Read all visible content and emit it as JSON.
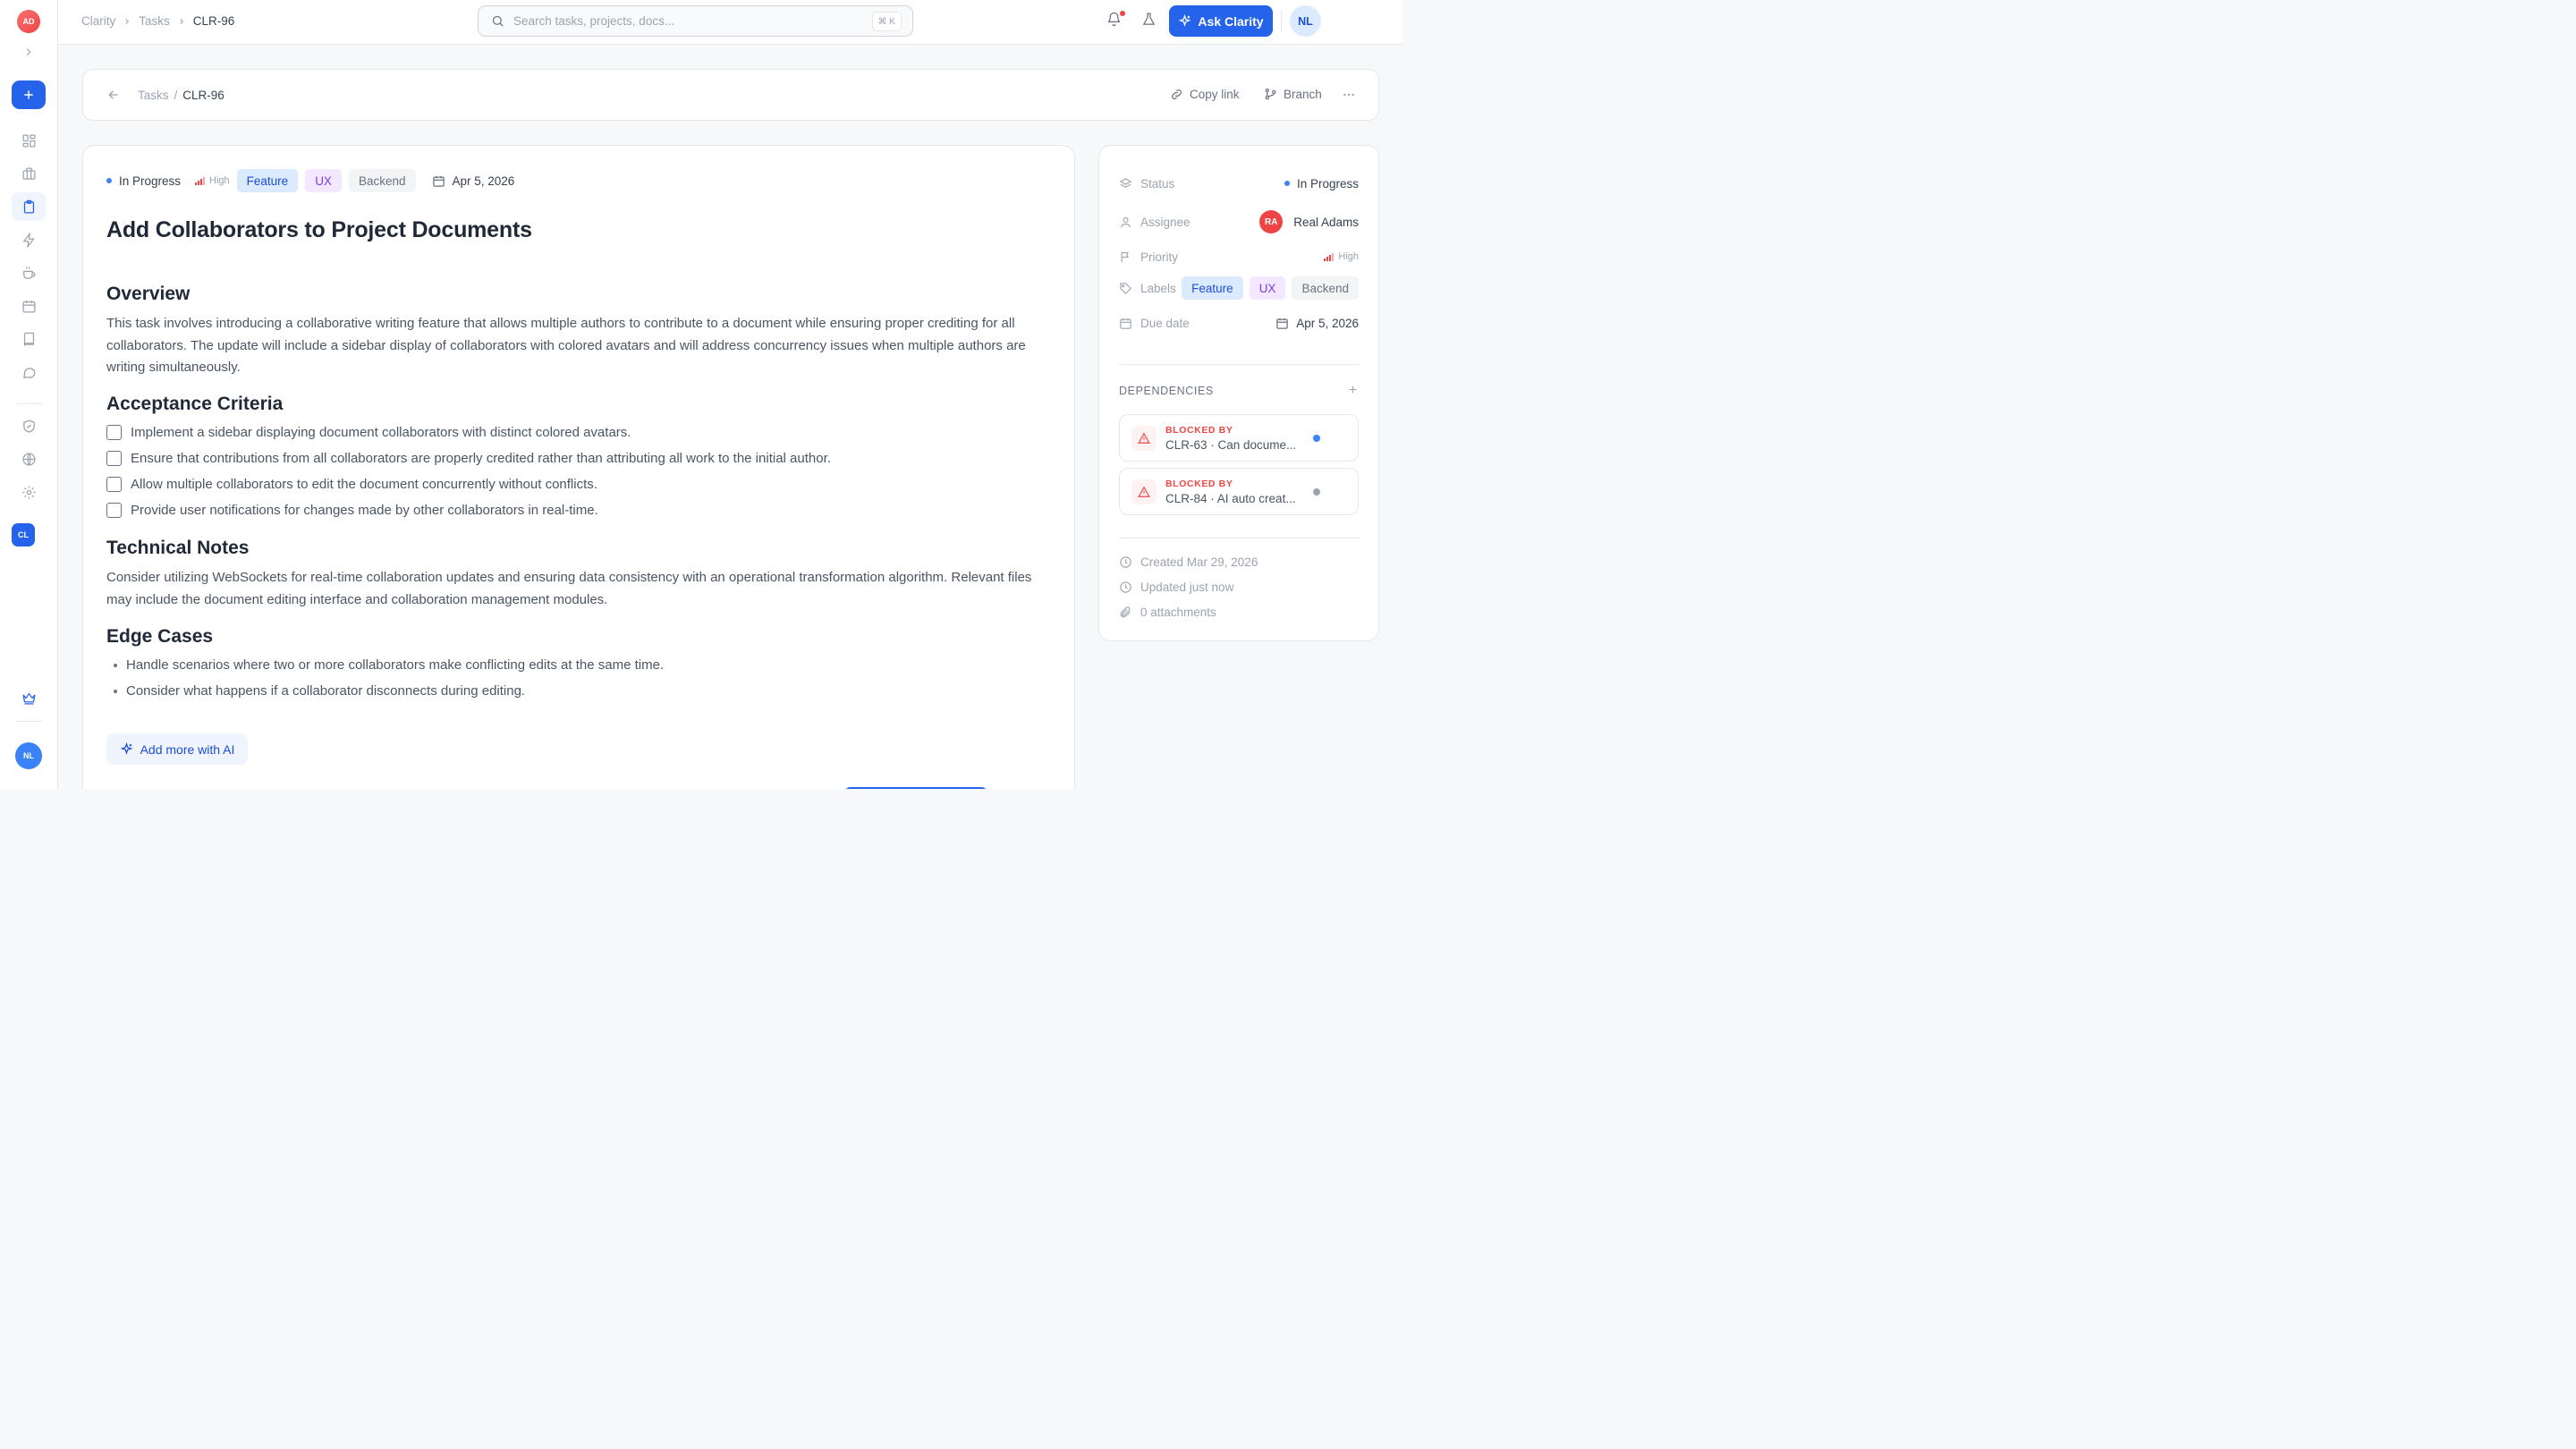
{
  "rail": {
    "logo_initials": "AD",
    "workspace_badge": "CL",
    "user_initials": "NL"
  },
  "topbar": {
    "breadcrumbs": [
      "Clarity",
      "Tasks",
      "CLR-96"
    ],
    "search_placeholder": "Search tasks, projects, docs...",
    "search_shortcut": "⌘ K",
    "ask_label": "Ask Clarity",
    "user_initials": "NL"
  },
  "subheader": {
    "crumb_parent": "Tasks",
    "crumb_sep": "/",
    "crumb_current": "CLR-96",
    "copy_link": "Copy link",
    "branch": "Branch"
  },
  "task": {
    "status": "In Progress",
    "priority": "High",
    "labels": [
      "Feature",
      "UX",
      "Backend"
    ],
    "due": "Apr 5, 2026",
    "title": "Add Collaborators to Project Documents",
    "overview_heading": "Overview",
    "overview_text": "This task involves introducing a collaborative writing feature that allows multiple authors to contribute to a document while ensuring proper crediting for all collaborators. The update will include a sidebar display of collaborators with colored avatars and will address concurrency issues when multiple authors are writing simultaneously.",
    "criteria_heading": "Acceptance Criteria",
    "criteria": [
      "Implement a sidebar displaying document collaborators with distinct colored avatars.",
      "Ensure that contributions from all collaborators are properly credited rather than attributing all work to the initial author.",
      "Allow multiple collaborators to edit the document concurrently without conflicts.",
      "Provide user notifications for changes made by other collaborators in real-time."
    ],
    "tech_heading": "Technical Notes",
    "tech_text": "Consider utilizing WebSockets for real-time collaboration updates and ensuring data consistency with an operational transformation algorithm. Relevant files may include the document editing interface and collaboration management modules.",
    "edge_heading": "Edge Cases",
    "edge_cases": [
      "Handle scenarios where two or more collaborators make conflicting edits at the same time.",
      "Consider what happens if a collaborator disconnects during editing."
    ],
    "ai_button": "Add more with AI"
  },
  "sidebar": {
    "status_label": "Status",
    "status_value": "In Progress",
    "assignee_label": "Assignee",
    "assignee_initials": "RA",
    "assignee_name": "Real Adams",
    "priority_label": "Priority",
    "priority_value": "High",
    "labels_label": "Labels",
    "labels": [
      "Feature",
      "UX",
      "Backend"
    ],
    "due_label": "Due date",
    "due_value": "Apr 5, 2026",
    "dependencies_heading": "DEPENDENCIES",
    "dependencies": [
      {
        "kind": "BLOCKED BY",
        "name": "CLR-63 · Can docume...",
        "color": "#3b82f6"
      },
      {
        "kind": "BLOCKED BY",
        "name": "CLR-84 · AI auto creat...",
        "color": "#9ca3af"
      }
    ],
    "created": "Created Mar 29, 2026",
    "updated": "Updated just now",
    "attachments": "0 attachments"
  },
  "colors": {
    "accent": "#2563eb",
    "danger": "#ef4444"
  }
}
